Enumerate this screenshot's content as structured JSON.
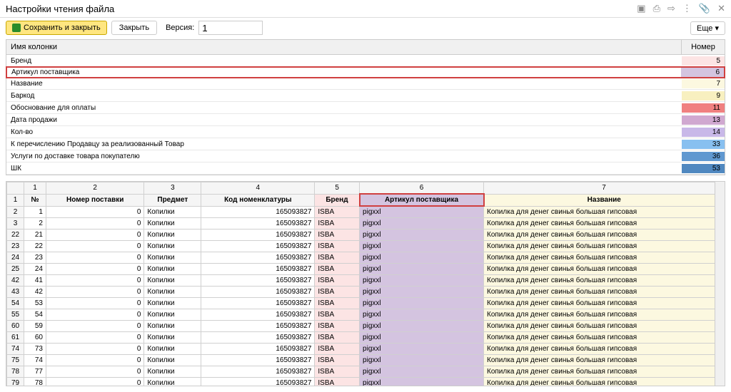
{
  "window": {
    "title": "Настройки чтения файла"
  },
  "toolbar": {
    "save_label": "Сохранить и закрыть",
    "close_label": "Закрыть",
    "version_label": "Версия:",
    "version_value": "1",
    "more_label": "Еще ▾"
  },
  "columns_header": {
    "name": "Имя колонки",
    "number": "Номер"
  },
  "columns": [
    {
      "name": "Бренд",
      "num": "5",
      "bg": "#fce4e4"
    },
    {
      "name": "Артикул поставщика",
      "num": "6",
      "bg": "#d4c4e0",
      "sel": true
    },
    {
      "name": "Название",
      "num": "7",
      "bg": "#fcf8e0"
    },
    {
      "name": "Баркод",
      "num": "9",
      "bg": "#f8f0c0"
    },
    {
      "name": "Обоснование для оплаты",
      "num": "11",
      "bg": "#f08080"
    },
    {
      "name": "Дата продажи",
      "num": "13",
      "bg": "#d0a8d0"
    },
    {
      "name": "Кол-во",
      "num": "14",
      "bg": "#c8b8e8"
    },
    {
      "name": "К перечислению Продавцу за реализованный Товар",
      "num": "33",
      "bg": "#88c0f0"
    },
    {
      "name": "Услуги по доставке товара покупателю",
      "num": "36",
      "bg": "#6098d0"
    },
    {
      "name": "ШК",
      "num": "53",
      "bg": "#5088c0"
    }
  ],
  "table": {
    "col_nums": [
      "",
      "1",
      "2",
      "3",
      "4",
      "5",
      "6",
      "7"
    ],
    "headers": [
      "",
      "№",
      "Номер поставки",
      "Предмет",
      "Код номенклатуры",
      "Бренд",
      "Артикул поставщика",
      "Название"
    ],
    "rows": [
      [
        "2",
        "1",
        "0",
        "Копилки",
        "165093827",
        "ISBA",
        "pigxxl",
        "Копилка для денег свинья большая гипсовая"
      ],
      [
        "3",
        "2",
        "0",
        "Копилки",
        "165093827",
        "ISBA",
        "pigxxl",
        "Копилка для денег свинья большая гипсовая"
      ],
      [
        "22",
        "21",
        "0",
        "Копилки",
        "165093827",
        "ISBA",
        "pigxxl",
        "Копилка для денег свинья большая гипсовая"
      ],
      [
        "23",
        "22",
        "0",
        "Копилки",
        "165093827",
        "ISBA",
        "pigxxl",
        "Копилка для денег свинья большая гипсовая"
      ],
      [
        "24",
        "23",
        "0",
        "Копилки",
        "165093827",
        "ISBA",
        "pigxxl",
        "Копилка для денег свинья большая гипсовая"
      ],
      [
        "25",
        "24",
        "0",
        "Копилки",
        "165093827",
        "ISBA",
        "pigxxl",
        "Копилка для денег свинья большая гипсовая"
      ],
      [
        "42",
        "41",
        "0",
        "Копилки",
        "165093827",
        "ISBA",
        "pigxxl",
        "Копилка для денег свинья большая гипсовая"
      ],
      [
        "43",
        "42",
        "0",
        "Копилки",
        "165093827",
        "ISBA",
        "pigxxl",
        "Копилка для денег свинья большая гипсовая"
      ],
      [
        "54",
        "53",
        "0",
        "Копилки",
        "165093827",
        "ISBA",
        "pigxxl",
        "Копилка для денег свинья большая гипсовая"
      ],
      [
        "55",
        "54",
        "0",
        "Копилки",
        "165093827",
        "ISBA",
        "pigxxl",
        "Копилка для денег свинья большая гипсовая"
      ],
      [
        "60",
        "59",
        "0",
        "Копилки",
        "165093827",
        "ISBA",
        "pigxxl",
        "Копилка для денег свинья большая гипсовая"
      ],
      [
        "61",
        "60",
        "0",
        "Копилки",
        "165093827",
        "ISBA",
        "pigxxl",
        "Копилка для денег свинья большая гипсовая"
      ],
      [
        "74",
        "73",
        "0",
        "Копилки",
        "165093827",
        "ISBA",
        "pigxxl",
        "Копилка для денег свинья большая гипсовая"
      ],
      [
        "75",
        "74",
        "0",
        "Копилки",
        "165093827",
        "ISBA",
        "pigxxl",
        "Копилка для денег свинья большая гипсовая"
      ],
      [
        "78",
        "77",
        "0",
        "Копилки",
        "165093827",
        "ISBA",
        "pigxxl",
        "Копилка для денег свинья большая гипсовая"
      ],
      [
        "79",
        "78",
        "0",
        "Копилки",
        "165093827",
        "ISBA",
        "pigxxl",
        "Копилка для денег свинья большая гипсовая"
      ]
    ]
  }
}
